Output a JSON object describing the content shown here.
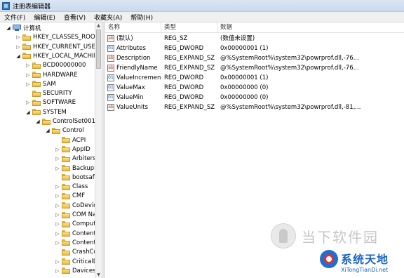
{
  "window": {
    "title": "注册表编辑器"
  },
  "menu": [
    "文件(F)",
    "编辑(E)",
    "查看(V)",
    "收藏夹(A)",
    "帮助(H)"
  ],
  "tree": [
    {
      "label": "计算机",
      "icon": "computer",
      "state": "open"
    },
    {
      "label": "HKEY_CLASSES_ROOT",
      "icon": "folder",
      "state": "closed"
    },
    {
      "label": "HKEY_CURRENT_USER",
      "icon": "folder",
      "state": "closed"
    },
    {
      "label": "HKEY_LOCAL_MACHINE",
      "icon": "folder",
      "state": "open"
    },
    {
      "label": "BCD00000000",
      "icon": "folder",
      "state": "closed"
    },
    {
      "label": "HARDWARE",
      "icon": "folder",
      "state": "closed"
    },
    {
      "label": "SAM",
      "icon": "folder",
      "state": "closed"
    },
    {
      "label": "SECURITY",
      "icon": "folder",
      "state": "none"
    },
    {
      "label": "SOFTWARE",
      "icon": "folder",
      "state": "closed"
    },
    {
      "label": "SYSTEM",
      "icon": "folder",
      "state": "open"
    },
    {
      "label": "ControlSet001",
      "icon": "folder",
      "state": "open"
    },
    {
      "label": "Control",
      "icon": "folder",
      "state": "open"
    },
    {
      "label": "ACPI",
      "icon": "folder",
      "state": "none"
    },
    {
      "label": "AppID",
      "icon": "folder",
      "state": "closed"
    },
    {
      "label": "Arbiters",
      "icon": "folder",
      "state": "closed"
    },
    {
      "label": "BackupRe",
      "icon": "folder",
      "state": "closed"
    },
    {
      "label": "bootsafe",
      "icon": "folder",
      "state": "none"
    },
    {
      "label": "Class",
      "icon": "folder",
      "state": "closed"
    },
    {
      "label": "CMF",
      "icon": "folder",
      "state": "closed"
    },
    {
      "label": "CoDeviceI",
      "icon": "folder",
      "state": "closed"
    },
    {
      "label": "COM Nan",
      "icon": "folder",
      "state": "closed"
    },
    {
      "label": "Computer",
      "icon": "folder",
      "state": "closed"
    },
    {
      "label": "ContentIn",
      "icon": "folder",
      "state": "closed"
    },
    {
      "label": "ContentIn",
      "icon": "folder",
      "state": "closed"
    },
    {
      "label": "CrashCon",
      "icon": "folder",
      "state": "none"
    },
    {
      "label": "CriticalDe",
      "icon": "folder",
      "state": "closed"
    },
    {
      "label": "Davices",
      "icon": "folder",
      "state": "closed"
    }
  ],
  "columns": [
    "名称",
    "类型",
    "数据"
  ],
  "values": [
    {
      "name": "(默认)",
      "type": "REG_SZ",
      "data": "(数值未设置)",
      "icon": "string-value-icon"
    },
    {
      "name": "Attributes",
      "type": "REG_DWORD",
      "data": "0x00000001 (1)",
      "icon": "binary-value-icon"
    },
    {
      "name": "Description",
      "type": "REG_EXPAND_SZ",
      "data": "@%SystemRoot%\\system32\\powrprof.dll,-76...",
      "icon": "string-value-icon"
    },
    {
      "name": "FriendlyName",
      "type": "REG_EXPAND_SZ",
      "data": "@%SystemRoot%\\system32\\powrprof.dll,-76...",
      "icon": "string-value-icon"
    },
    {
      "name": "ValueIncrement",
      "type": "REG_DWORD",
      "data": "0x00000001 (1)",
      "icon": "binary-value-icon"
    },
    {
      "name": "ValueMax",
      "type": "REG_DWORD",
      "data": "0x00000000 (0)",
      "icon": "binary-value-icon"
    },
    {
      "name": "ValueMin",
      "type": "REG_DWORD",
      "data": "0x00000000 (0)",
      "icon": "binary-value-icon"
    },
    {
      "name": "ValueUnits",
      "type": "REG_EXPAND_SZ",
      "data": "@%SystemRoot%\\system32\\powrprof.dll,-81,...",
      "icon": "string-value-icon"
    }
  ],
  "watermarks": {
    "site1": "当下软件园",
    "site2_title": "系统天地",
    "site2_url": "XiTongTianDi.net"
  }
}
